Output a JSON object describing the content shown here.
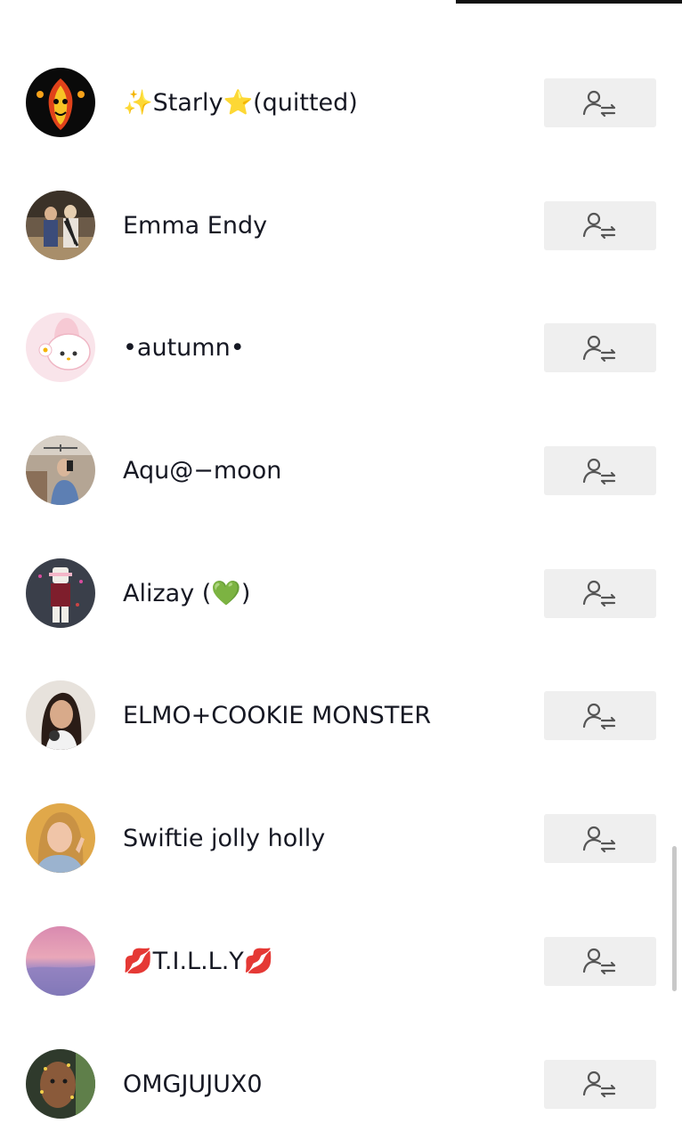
{
  "users": [
    {
      "name": "✨Starly⭐(quitted)",
      "avatar": "avatar-flame-clown"
    },
    {
      "name": "Emma Endy",
      "avatar": "avatar-two-kids"
    },
    {
      "name": "•autumn•",
      "avatar": "avatar-pink-bunny"
    },
    {
      "name": "Aqu@−moon",
      "avatar": "avatar-mirror-selfie"
    },
    {
      "name": "Alizay (💚)",
      "avatar": "avatar-game-character"
    },
    {
      "name": "ELMO+COOKIE MONSTER",
      "avatar": "avatar-girl-portrait"
    },
    {
      "name": "Swiftie jolly holly",
      "avatar": "avatar-blonde-girl"
    },
    {
      "name": "💋T.I.L.L.Y💋",
      "avatar": "avatar-pink-sky"
    },
    {
      "name": "OMGJUJUX0",
      "avatar": "avatar-face-sparkles"
    }
  ],
  "button_icon": "friends-icon",
  "colors": {
    "background": "#ffffff",
    "text": "#161823",
    "button_bg": "#efefef",
    "icon": "#555555"
  }
}
